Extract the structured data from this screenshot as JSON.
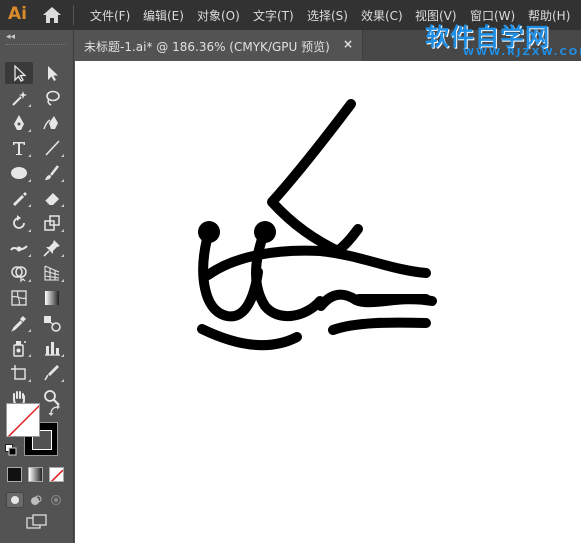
{
  "app": {
    "logo": "Ai"
  },
  "menu": [
    {
      "label": "文件(F)"
    },
    {
      "label": "编辑(E)"
    },
    {
      "label": "对象(O)"
    },
    {
      "label": "文字(T)"
    },
    {
      "label": "选择(S)"
    },
    {
      "label": "效果(C)"
    },
    {
      "label": "视图(V)"
    },
    {
      "label": "窗口(W)"
    },
    {
      "label": "帮助(H)"
    }
  ],
  "watermark": {
    "main": "软件自学网",
    "sub": "WWW.RJZXW.COM"
  },
  "toolbar": {
    "collapse_glyph": "◂◂"
  },
  "document_tab": {
    "title": "未标题-1.ai* @ 186.36% (CMYK/GPU 预览)",
    "close_glyph": "×"
  },
  "colors": {
    "fill": "#ffffff",
    "stroke": "#000000",
    "none_slash": "#e02020",
    "accent_logo": "#d98a2b",
    "watermark": "#1f8fe6"
  }
}
